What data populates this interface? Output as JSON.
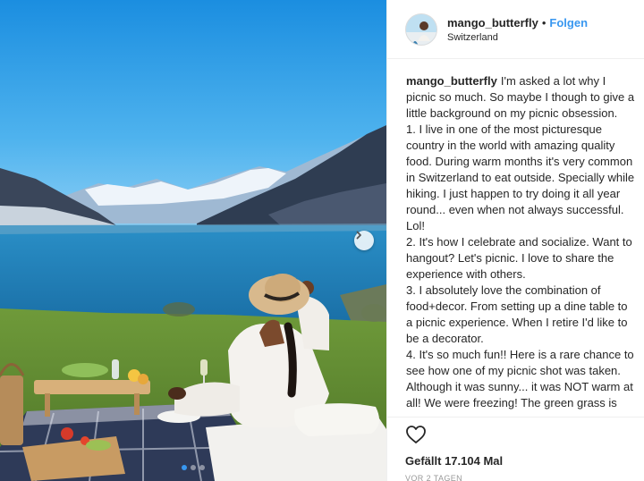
{
  "post": {
    "username": "mango_butterfly",
    "separator": "•",
    "follow_label": "Folgen",
    "location": "Switzerland",
    "caption_user": "mango_butterfly",
    "caption_text": "I'm asked a lot why I picnic so much. So maybe I though to give a little background on my picnic obsession.\n1. I live in one of the most picturesque country in the world with amazing quality food. During warm months it's very common in Switzerland to eat outside. Specially while hiking. I just happen to try doing it all year round... even when not always successful. Lol!\n2. It's how I celebrate and socialize. Want to hangout? Let's picnic. I love to share the experience with others.\n3. I absolutely love the combination of food+decor. From setting up a dine table to a picnic experience. When I retire I'd like to be a decorator.\n4. It's so much fun!! Here is a rare chance to see how one of my picnic shot was taken. Although it was sunny... it was NOT warm at all! We were freezing! The green grass is actually mud. Hahah. We had mud all the way up to our knees. But the",
    "likes_text": "Gefällt 17.104 Mal",
    "time_text": "VOR 2 TAGEN"
  },
  "icons": {
    "like": "heart-icon",
    "next": "chevron-right-icon",
    "carousel": "carousel-dots"
  },
  "colors": {
    "accent": "#3897f0",
    "text": "#262626",
    "muted": "#999999"
  }
}
